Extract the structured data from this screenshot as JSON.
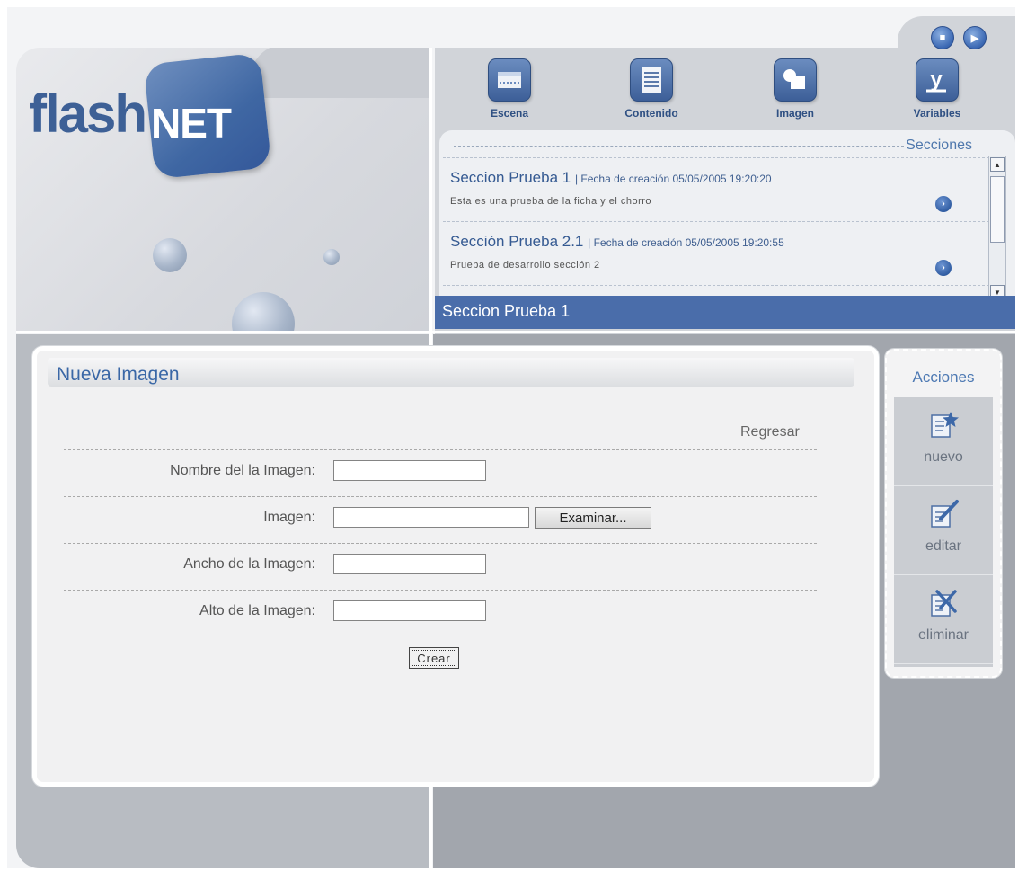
{
  "brand": {
    "flash": "flash",
    "net": "NET"
  },
  "nav": [
    {
      "label": "Escena",
      "icon": "scene-icon"
    },
    {
      "label": "Contenido",
      "icon": "document-icon"
    },
    {
      "label": "Imagen",
      "icon": "image-icon"
    },
    {
      "label": "Variables",
      "icon": "variables-icon"
    }
  ],
  "secciones": {
    "title": "Secciones",
    "items": [
      {
        "name": "Seccion Prueba 1",
        "date": "| Fecha de creación 05/05/2005 19:20:20",
        "description": "Esta es una prueba de la ficha y el chorro"
      },
      {
        "name": "Sección Prueba 2.1",
        "date": "| Fecha de creación 05/05/2005 19:20:55",
        "description": "Prueba de desarrollo sección 2"
      }
    ],
    "current": "Seccion Prueba 1"
  },
  "form": {
    "title": "Nueva Imagen",
    "back_link": "Regresar",
    "fields": {
      "nombre": {
        "label": "Nombre del la Imagen:",
        "value": ""
      },
      "imagen": {
        "label": "Imagen:",
        "value": ""
      },
      "ancho": {
        "label": "Ancho de la Imagen:",
        "value": ""
      },
      "alto": {
        "label": "Alto de la Imagen:",
        "value": ""
      }
    },
    "browse_button": "Examinar...",
    "submit_button": "Crear"
  },
  "actions": {
    "title": "Acciones",
    "items": [
      {
        "label": "nuevo",
        "icon": "new-star-icon"
      },
      {
        "label": "editar",
        "icon": "edit-pencil-icon"
      },
      {
        "label": "eliminar",
        "icon": "delete-x-icon"
      }
    ]
  },
  "colors": {
    "accent": "#3a67a6",
    "selection_bar": "#4a6daa",
    "panel": "#f1f1f2"
  }
}
